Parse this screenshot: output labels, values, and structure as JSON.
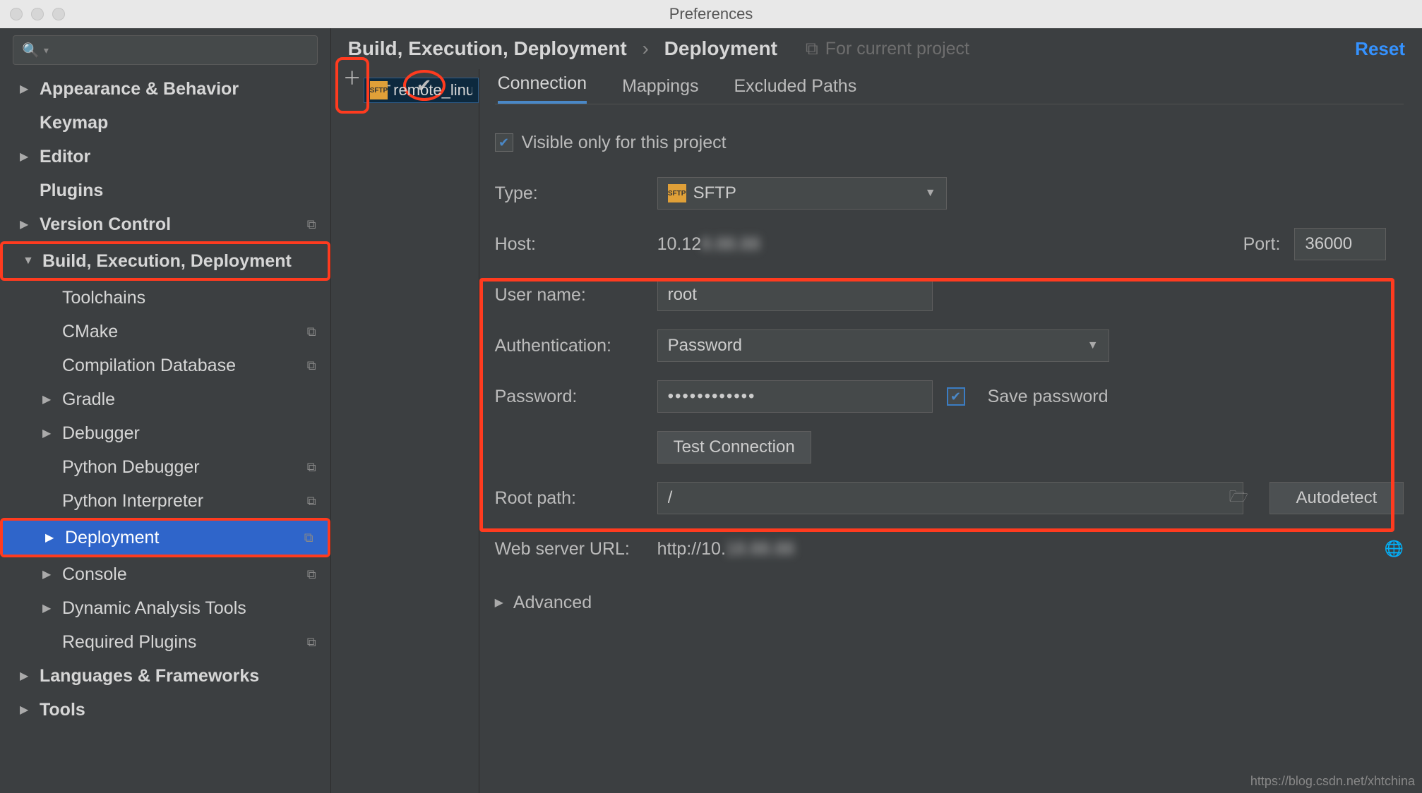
{
  "window": {
    "title": "Preferences"
  },
  "sidebar": {
    "search_placeholder": "",
    "items": [
      {
        "label": "Appearance & Behavior",
        "arrow": "▶"
      },
      {
        "label": "Keymap"
      },
      {
        "label": "Editor",
        "arrow": "▶"
      },
      {
        "label": "Plugins"
      },
      {
        "label": "Version Control",
        "arrow": "▶",
        "copy": true
      },
      {
        "label": "Build, Execution, Deployment",
        "arrow": "▼",
        "highlight": true
      },
      {
        "label": "Toolchains",
        "level": 2
      },
      {
        "label": "CMake",
        "level": 2,
        "copy": true
      },
      {
        "label": "Compilation Database",
        "level": 2,
        "copy": true
      },
      {
        "label": "Gradle",
        "level": 2,
        "arrow": "▶"
      },
      {
        "label": "Debugger",
        "level": 2,
        "arrow": "▶"
      },
      {
        "label": "Python Debugger",
        "level": 2,
        "copy": true
      },
      {
        "label": "Python Interpreter",
        "level": 2,
        "copy": true
      },
      {
        "label": "Deployment",
        "level": 2,
        "arrow": "▶",
        "selected": true,
        "copy": true,
        "highlight": true
      },
      {
        "label": "Console",
        "level": 2,
        "arrow": "▶",
        "copy": true
      },
      {
        "label": "Dynamic Analysis Tools",
        "level": 2,
        "arrow": "▶"
      },
      {
        "label": "Required Plugins",
        "level": 2,
        "copy": true
      },
      {
        "label": "Languages & Frameworks",
        "arrow": "▶"
      },
      {
        "label": "Tools",
        "arrow": "▶"
      }
    ]
  },
  "breadcrumb": {
    "a": "Build, Execution, Deployment",
    "b": "Deployment",
    "for_project": "For current project",
    "reset": "Reset"
  },
  "servers": {
    "selected": "remote_linu"
  },
  "tabs": {
    "connection": "Connection",
    "mappings": "Mappings",
    "excluded": "Excluded Paths"
  },
  "form": {
    "visible_label": "Visible only for this project",
    "type_label": "Type:",
    "type_value": "SFTP",
    "host_label": "Host:",
    "host_value": "10.12",
    "port_label": "Port:",
    "port_value": "36000",
    "user_label": "User name:",
    "user_value": "root",
    "auth_label": "Authentication:",
    "auth_value": "Password",
    "pass_label": "Password:",
    "pass_value": "••••••••••••",
    "save_pass": "Save password",
    "test_btn": "Test Connection",
    "root_label": "Root path:",
    "root_value": "/",
    "autodetect": "Autodetect",
    "web_label": "Web server URL:",
    "web_value": "http://10.",
    "advanced": "Advanced"
  },
  "watermark": "https://blog.csdn.net/xhtchina"
}
